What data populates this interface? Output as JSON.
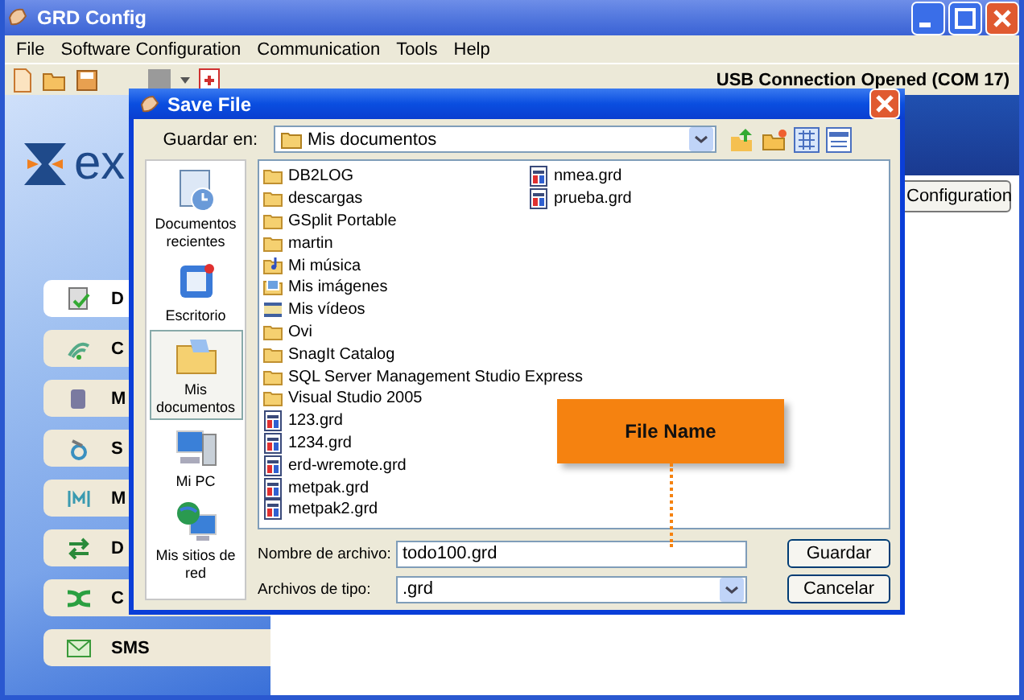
{
  "window": {
    "title": "GRD Config"
  },
  "menu": [
    "File",
    "Software Configuration",
    "Communication",
    "Tools",
    "Help"
  ],
  "toolbar": {
    "status": "USB Connection Opened (COM 17)"
  },
  "logo": {
    "text": "ex"
  },
  "nav_items": [
    {
      "label": "D",
      "selected": true
    },
    {
      "label": "C",
      "selected": false
    },
    {
      "label": "M",
      "selected": false
    },
    {
      "label": "S",
      "selected": false
    },
    {
      "label": "M",
      "selected": false
    },
    {
      "label": "D",
      "selected": false
    },
    {
      "label": "C",
      "selected": false
    },
    {
      "label": "SMS",
      "selected": false
    }
  ],
  "configuration_button": "Configuration",
  "dialog": {
    "title": "Save File",
    "save_in_label": "Guardar en:",
    "save_in_value": "Mis documentos",
    "places": [
      {
        "label": "Documentos recientes",
        "selected": false
      },
      {
        "label": "Escritorio",
        "selected": false
      },
      {
        "label": "Mis documentos",
        "selected": true
      },
      {
        "label": "Mi PC",
        "selected": false
      },
      {
        "label": "Mis sitios de red",
        "selected": false
      }
    ],
    "files": [
      {
        "name": "DB2LOG",
        "kind": "folder"
      },
      {
        "name": "descargas",
        "kind": "folder"
      },
      {
        "name": "GSplit Portable",
        "kind": "folder"
      },
      {
        "name": "martin",
        "kind": "folder"
      },
      {
        "name": "Mi música",
        "kind": "music"
      },
      {
        "name": "Mis imágenes",
        "kind": "pictures"
      },
      {
        "name": "Mis vídeos",
        "kind": "videos"
      },
      {
        "name": "Ovi",
        "kind": "folder"
      },
      {
        "name": "SnagIt Catalog",
        "kind": "folder"
      },
      {
        "name": "SQL Server Management Studio Express",
        "kind": "folder"
      },
      {
        "name": "Visual Studio 2005",
        "kind": "folder"
      },
      {
        "name": "123.grd",
        "kind": "file"
      },
      {
        "name": "1234.grd",
        "kind": "file"
      },
      {
        "name": "erd-wremote.grd",
        "kind": "file"
      },
      {
        "name": "metpak.grd",
        "kind": "file"
      },
      {
        "name": "metpak2.grd",
        "kind": "file"
      },
      {
        "name": "nmea.grd",
        "kind": "file"
      },
      {
        "name": "prueba.grd",
        "kind": "file"
      }
    ],
    "file_name_label": "Nombre de archivo:",
    "file_name_value": "todo100.grd",
    "file_type_label": "Archivos de tipo:",
    "file_type_value": ".grd",
    "buttons": [
      "Guardar",
      "Cancelar"
    ]
  },
  "callout": {
    "label": "File Name"
  }
}
